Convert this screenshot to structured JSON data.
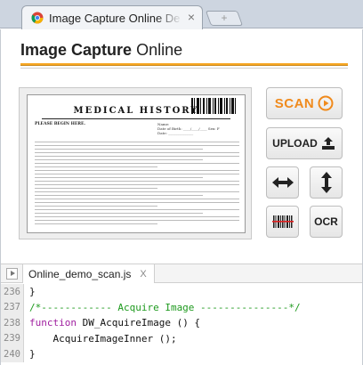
{
  "browser": {
    "tab_title": "Image Capture Online Demo",
    "tab_close": "×",
    "new_tab": "+"
  },
  "header": {
    "title_bold": "Image Capture",
    "title_rest": "Online"
  },
  "document": {
    "heading": "MEDICAL HISTORY",
    "please_begin": "PLEASE BEGIN HERE.",
    "field_name": "Name:",
    "field_dob": "Date of Birth: ____/____/____ Sex: F",
    "field_date": "Date: ______________"
  },
  "buttons": {
    "scan": "SCAN",
    "upload": "UPLOAD",
    "ocr": "OCR",
    "rotate_horizontal_icon": "left-right-arrow-icon",
    "rotate_vertical_icon": "up-down-arrow-icon",
    "barcode_icon": "barcode-icon"
  },
  "code_panel": {
    "file_name": "Online_demo_scan.js",
    "close": "X",
    "lines": [
      {
        "num": "236",
        "text": "}"
      },
      {
        "num": "237",
        "text": "/*------------ Acquire Image ---------------*/"
      },
      {
        "num": "238",
        "kw": "function",
        "text": " DW_AcquireImage () {"
      },
      {
        "num": "239",
        "text": "    AcquireImageInner ();"
      },
      {
        "num": "240",
        "text": "}"
      }
    ]
  },
  "colors": {
    "accent": "#f08a1c",
    "comment": "#1e9a1e",
    "keyword": "#a020a0"
  }
}
